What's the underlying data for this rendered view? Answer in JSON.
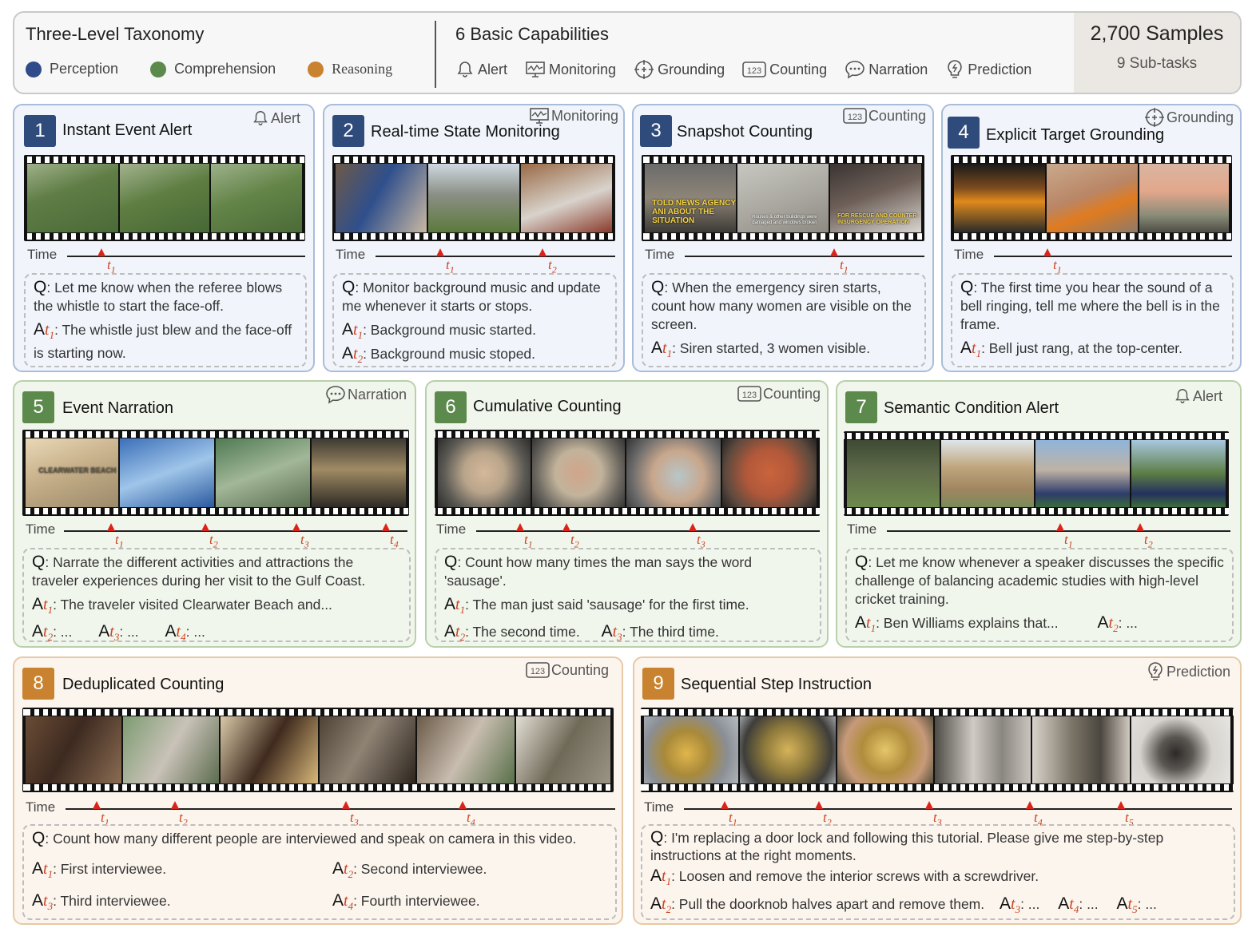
{
  "header": {
    "taxonomy_title": "Three-Level Taxonomy",
    "legend": [
      {
        "label": "Perception",
        "color": "#2f4b8a"
      },
      {
        "label": "Comprehension",
        "color": "#5b8a4c"
      },
      {
        "label": "Reasoning",
        "color": "#c9822f"
      }
    ],
    "capabilities_title": "6 Basic Capabilities",
    "capabilities": [
      {
        "label": "Alert",
        "icon": "bell-icon"
      },
      {
        "label": "Monitoring",
        "icon": "monitor-icon"
      },
      {
        "label": "Grounding",
        "icon": "crosshair-icon"
      },
      {
        "label": "Counting",
        "icon": "counter-123-icon"
      },
      {
        "label": "Narration",
        "icon": "speech-bubble-icon"
      },
      {
        "label": "Prediction",
        "icon": "bulb-icon"
      }
    ],
    "samples": "2,700 Samples",
    "subtasks": "9 Sub-tasks"
  },
  "common": {
    "time_label": "Time",
    "q": "Q",
    "a": "A",
    "t": "t"
  },
  "cards": [
    {
      "num": "1",
      "title": "Instant Event Alert",
      "tag": "Alert",
      "question": ": Let me know when the referee blows the whistle to start the face-off.",
      "answers": [
        ": The whistle just blew and the face-off is starting now."
      ]
    },
    {
      "num": "2",
      "title": "Real-time State Monitoring",
      "tag": "Monitoring",
      "question": ": Monitor background music and update me whenever it starts or stops.",
      "answers": [
        ": Background music started.",
        ": Background music stoped."
      ]
    },
    {
      "num": "3",
      "title": "Snapshot Counting",
      "tag": "Counting",
      "question": ": When the emergency siren starts, count how many women are visible on the screen.",
      "answers": [
        ": Siren started, 3 women visible."
      ],
      "frame_texts": [
        "TOLD NEWS AGENCY ANI ABOUT THE SITUATION",
        "Houses & other buildings were damaged and windows broken",
        "FOR RESCUE AND COUNTER-INSURGENCY OPERATION"
      ]
    },
    {
      "num": "4",
      "title": "Explicit Target Grounding",
      "tag": "Grounding",
      "question": ": The first time you hear the sound of a bell ringing, tell me where the bell is in the frame.",
      "answers": [
        ": Bell just rang, at the top-center."
      ]
    },
    {
      "num": "5",
      "title": "Event Narration",
      "tag": "Narration",
      "question": ": Narrate the different activities and attractions the traveler experiences during her visit to the Gulf Coast.",
      "answers": [
        ": The traveler visited Clearwater Beach and...",
        ": ...",
        ": ...",
        ": ..."
      ],
      "frame_texts": [
        "CLEARWATER BEACH"
      ]
    },
    {
      "num": "6",
      "title": "Cumulative Counting",
      "tag": "Counting",
      "question": ": Count how many times the man says the word 'sausage'.",
      "answers": [
        ": The man just said 'sausage' for the first time.",
        ": The second time.",
        ": The third time."
      ]
    },
    {
      "num": "7",
      "title": "Semantic Condition Alert",
      "tag": "Alert",
      "question": ": Let me know whenever a speaker discusses the specific challenge of balancing academic studies with high-level cricket training.",
      "answers": [
        ": Ben Williams explains that...",
        ": ..."
      ]
    },
    {
      "num": "8",
      "title": "Deduplicated Counting",
      "tag": "Counting",
      "question": ": Count how many different people are interviewed and speak on camera in this video.",
      "answers": [
        ": First interviewee.",
        ": Second interviewee.",
        ": Third interviewee.",
        ": Fourth interviewee."
      ]
    },
    {
      "num": "9",
      "title": "Sequential Step Instruction",
      "tag": "Prediction",
      "question": ": I'm replacing a door lock and following this tutorial. Please give me step-by-step instructions at the right moments.",
      "answers": [
        ": Loosen and remove the interior screws with a screwdriver.",
        ": Pull the doorknob halves apart and remove them.",
        ": ...",
        ": ...",
        ": ..."
      ]
    }
  ]
}
